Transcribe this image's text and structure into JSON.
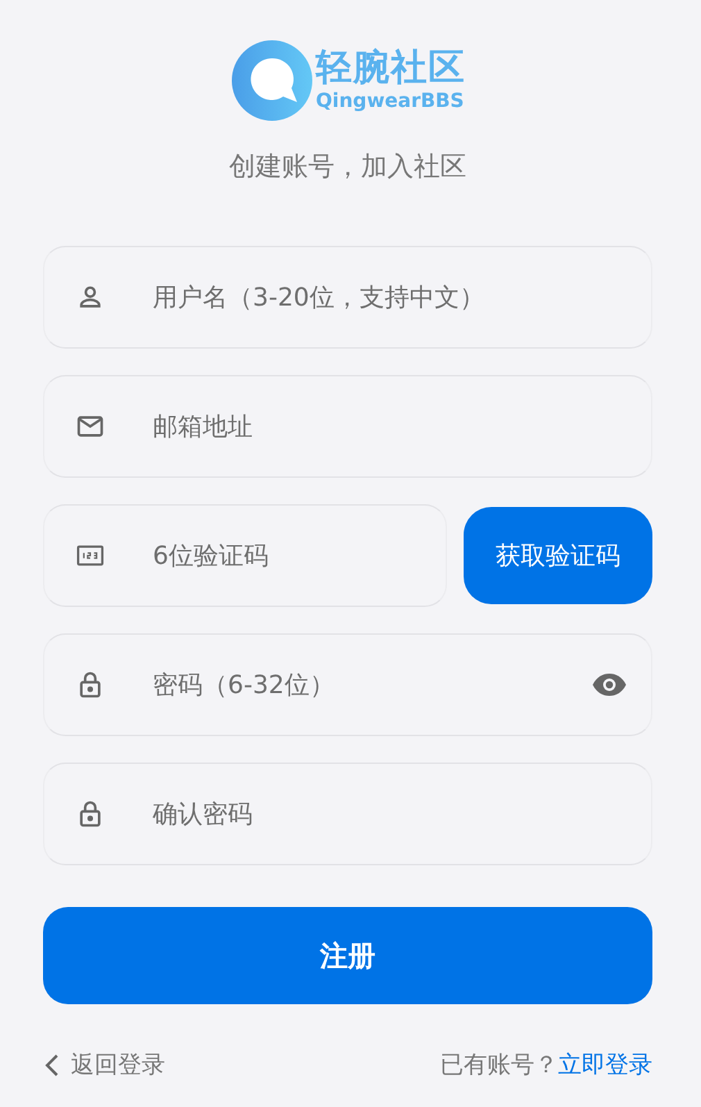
{
  "logo": {
    "title": "轻腕社区",
    "subtitle": "QingwearBBS"
  },
  "tagline": "创建账号，加入社区",
  "fields": [
    {
      "kind": "user",
      "placeholder": "用户名（3-20位，支持中文）",
      "reveal_toggle": false
    },
    {
      "kind": "email",
      "placeholder": "邮箱地址",
      "reveal_toggle": false
    },
    {
      "kind": "code",
      "placeholder": "6位验证码",
      "button": "获取验证码",
      "reveal_toggle": false
    },
    {
      "kind": "password",
      "placeholder": "密码（6-32位）",
      "reveal_toggle": true
    },
    {
      "kind": "password",
      "placeholder": "确认密码",
      "reveal_toggle": false
    }
  ],
  "submit": "注册",
  "footer": {
    "back": "返回登录",
    "prompt": "已有账号？",
    "link": "立即登录"
  }
}
